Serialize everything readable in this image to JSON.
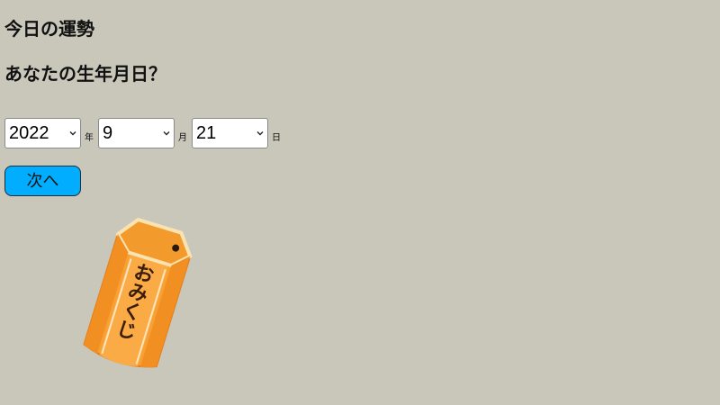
{
  "page": {
    "title": "今日の運勢",
    "question": "あなたの生年月日？"
  },
  "birthdate": {
    "year": {
      "value": "2022",
      "unit": "年"
    },
    "month": {
      "value": "9",
      "unit": "月"
    },
    "day": {
      "value": "21",
      "unit": "日"
    }
  },
  "actions": {
    "next_label": "次へ"
  },
  "illustration": {
    "icon": "omikuji-box-icon",
    "label": "おみくじ"
  },
  "colors": {
    "background": "#c8c7ba",
    "button": "#00adff",
    "omikuji_orange": "#f8a033"
  }
}
